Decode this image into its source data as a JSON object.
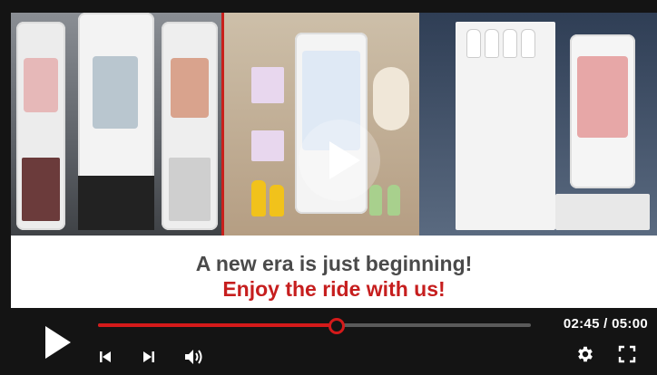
{
  "caption": {
    "line1": "A new era is just beginning!",
    "line2": "Enjoy the ride with us!"
  },
  "player": {
    "current_time": "02:45",
    "separator": " / ",
    "duration": "05:00",
    "progress": 0.55
  },
  "icons": {
    "big_play": "play-icon",
    "play": "play-icon",
    "previous": "skip-previous-icon",
    "next": "skip-next-icon",
    "volume": "volume-icon",
    "settings": "gear-icon",
    "fullscreen": "fullscreen-icon"
  },
  "colors": {
    "accent": "#d41a1a",
    "caption_red": "#c61e1e",
    "caption_gray": "#4a4a4a"
  }
}
